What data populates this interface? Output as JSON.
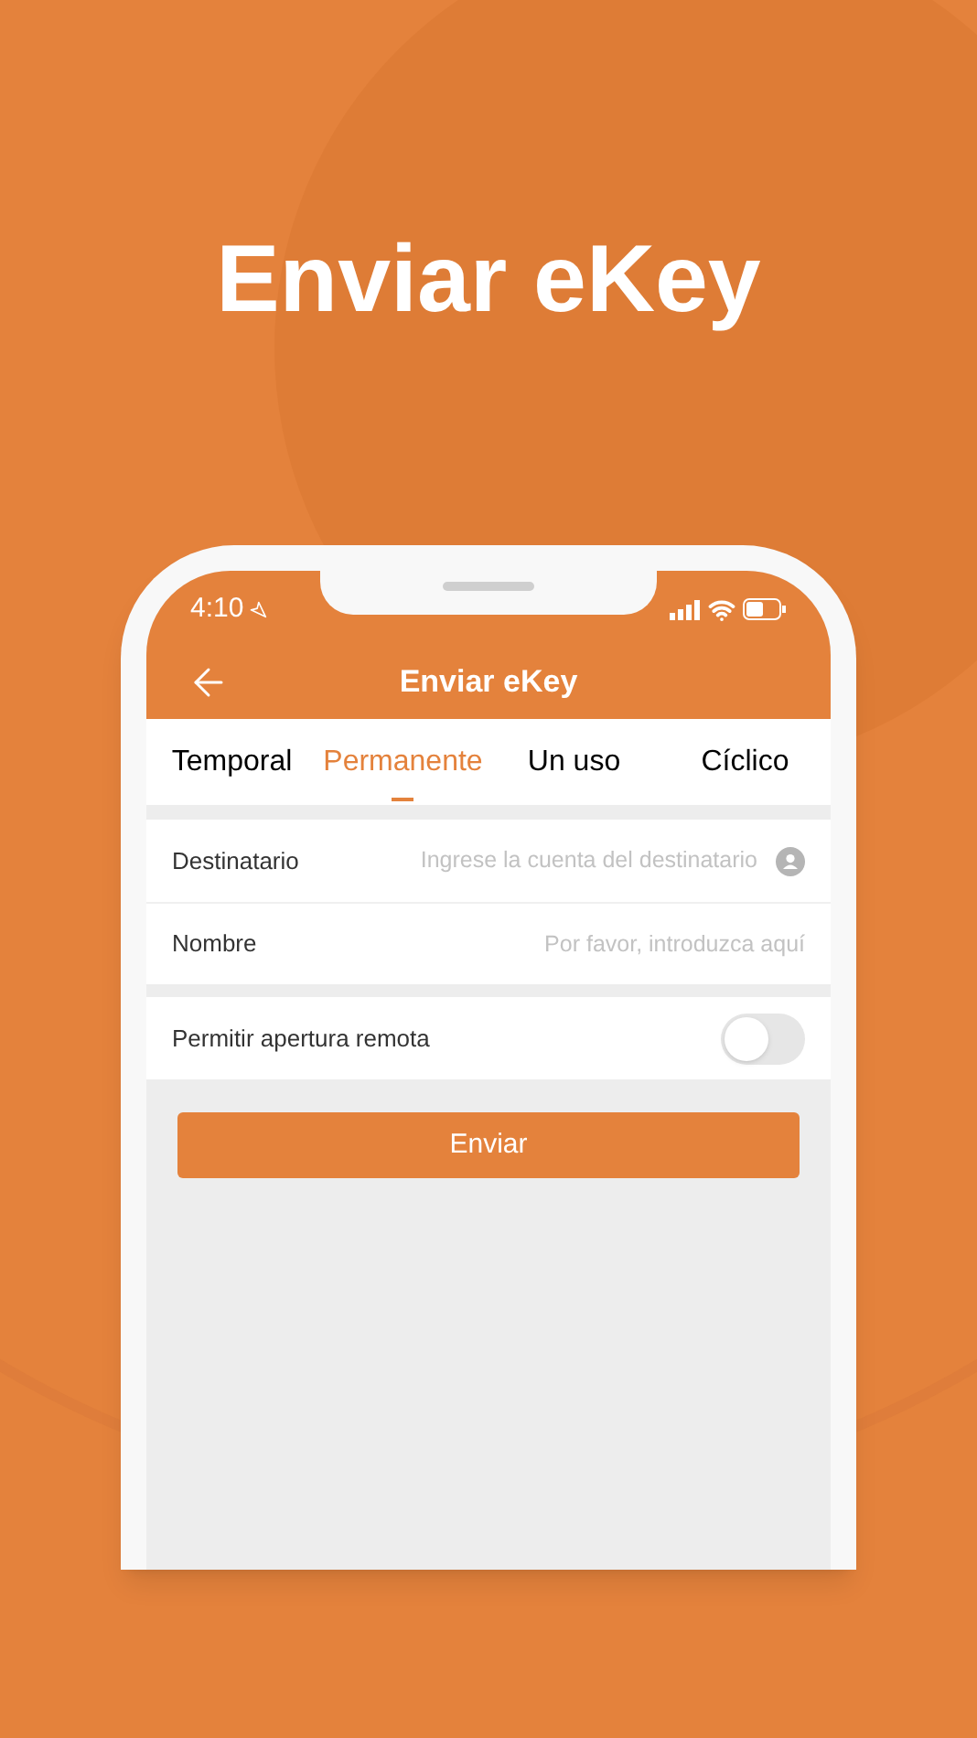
{
  "headline": "Enviar eKey",
  "status_bar": {
    "time": "4:10"
  },
  "nav_bar": {
    "title": "Enviar eKey"
  },
  "tabs": [
    {
      "label": "Temporal",
      "selected": false
    },
    {
      "label": "Permanente",
      "selected": true
    },
    {
      "label": "Un uso",
      "selected": false
    },
    {
      "label": "Cíclico",
      "selected": false
    }
  ],
  "fields": [
    {
      "label": "Destinatario",
      "placeholder": "Ingrese la cuenta del destinatario",
      "kind": "contact"
    },
    {
      "label": "Nombre",
      "placeholder": "Por favor, introduzca aquí",
      "kind": "text"
    }
  ],
  "remote_open": {
    "label": "Permitir apertura remota",
    "on": false
  },
  "submit_button": "Enviar"
}
